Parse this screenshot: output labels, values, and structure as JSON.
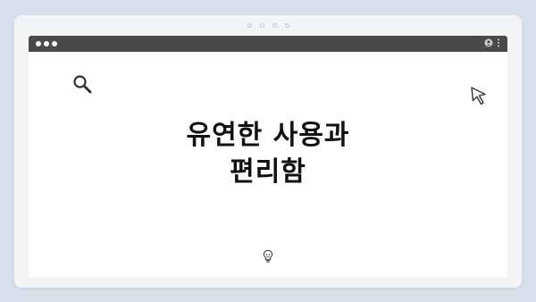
{
  "frame": {
    "dots": 4
  },
  "window": {
    "titlebar": {
      "bg": "#4a4a4a"
    },
    "icons": [
      "search-icon",
      "cursor-arrow-icon",
      "lightbulb-icon",
      "profile-icon",
      "more-vert-icon"
    ]
  },
  "main": {
    "title_line1": "유연한 사용과",
    "title_line2": "편리함"
  }
}
